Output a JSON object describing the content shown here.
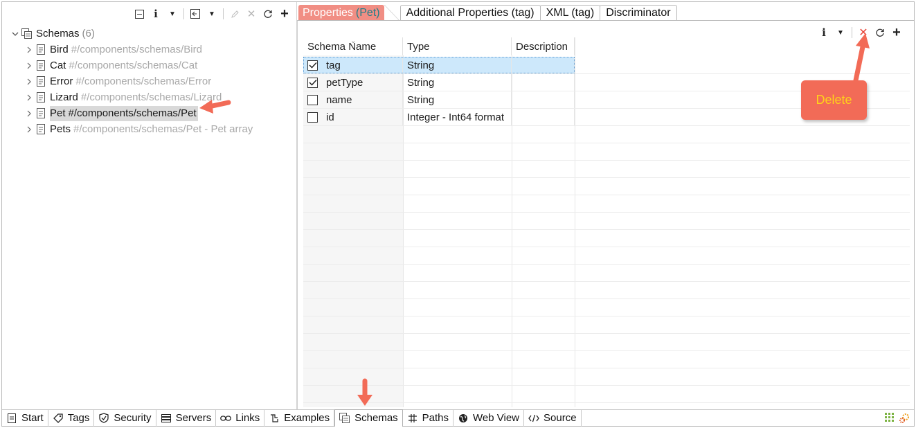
{
  "left": {
    "toolbar": [
      "collapse-all",
      "info",
      "dropdown",
      "export",
      "dropdown",
      "edit",
      "delete",
      "refresh",
      "add"
    ],
    "tree": {
      "root_label": "Schemas",
      "root_count": "(6)",
      "items": [
        {
          "label": "Bird",
          "path": "#/components/schemas/Bird"
        },
        {
          "label": "Cat",
          "path": "#/components/schemas/Cat"
        },
        {
          "label": "Error",
          "path": "#/components/schemas/Error"
        },
        {
          "label": "Lizard",
          "path": "#/components/schemas/Lizard"
        },
        {
          "label": "Pet",
          "path": "#/components/schemas/Pet"
        },
        {
          "label": "Pets",
          "path": "#/components/schemas/Pet - Pet array"
        }
      ],
      "selected": "Pet"
    }
  },
  "right": {
    "tabs": [
      {
        "label": "Properties",
        "context": "(Pet)"
      },
      {
        "label": "Additional Properties (tag)"
      },
      {
        "label": "XML (tag)"
      },
      {
        "label": "Discriminator"
      }
    ],
    "grid": {
      "headers": [
        "Schema Name",
        "Type",
        "Description"
      ],
      "rows": [
        {
          "name": "tag",
          "type": "String",
          "description": "",
          "checked": true
        },
        {
          "name": "petType",
          "type": "String",
          "description": "",
          "checked": true
        },
        {
          "name": "name",
          "type": "String",
          "description": "",
          "checked": false
        },
        {
          "name": "id",
          "type": "Integer - Int64 format",
          "description": "",
          "checked": false
        }
      ]
    }
  },
  "bottom_tabs": [
    {
      "label": "Start",
      "icon": "page-icon"
    },
    {
      "label": "Tags",
      "icon": "tag-icon"
    },
    {
      "label": "Security",
      "icon": "shield-icon"
    },
    {
      "label": "Servers",
      "icon": "server-icon"
    },
    {
      "label": "Links",
      "icon": "link-icon"
    },
    {
      "label": "Examples",
      "icon": "examples-icon"
    },
    {
      "label": "Schemas",
      "icon": "schemas-icon"
    },
    {
      "label": "Paths",
      "icon": "paths-icon"
    },
    {
      "label": "Web View",
      "icon": "globe-icon"
    },
    {
      "label": "Source",
      "icon": "code-icon"
    }
  ],
  "active_bottom_tab": "Schemas",
  "annotation": {
    "callout": "Delete"
  },
  "colors": {
    "accent_tab": "#f18e84",
    "callout": "#f26b57",
    "callout_text": "#ffd21a",
    "selection": "#cde8fb",
    "delete_x": "#e8473b"
  }
}
